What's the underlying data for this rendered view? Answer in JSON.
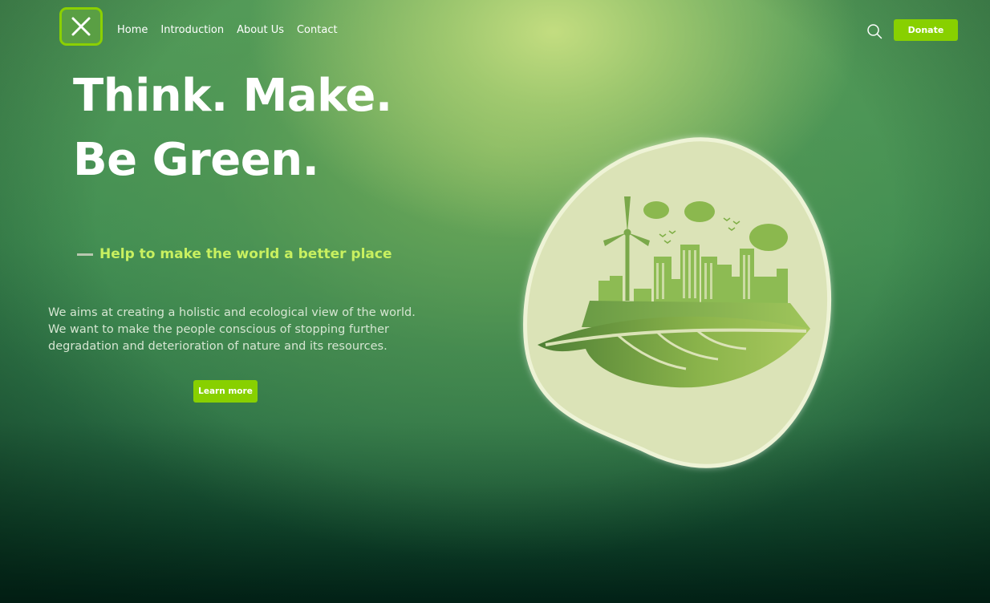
{
  "nav": {
    "links": [
      "Home",
      "Introduction",
      "About Us",
      "Contact"
    ],
    "donate_label": "Donate"
  },
  "icons": {
    "logo": "close-x-icon",
    "search": "search-icon"
  },
  "hero": {
    "headline_line1": "Think. Make.",
    "headline_line2": "Be Green.",
    "tagline": "Help to make the world a better place",
    "description": "We aims at creating a holistic and ecological view of the world. We want to make the people conscious of stopping further degradation and deterioration of nature and its resources.",
    "cta_label": "Learn more"
  },
  "colors": {
    "accent": "#88d000",
    "tagline": "#c8f060",
    "blob": "#dbe3b7"
  }
}
